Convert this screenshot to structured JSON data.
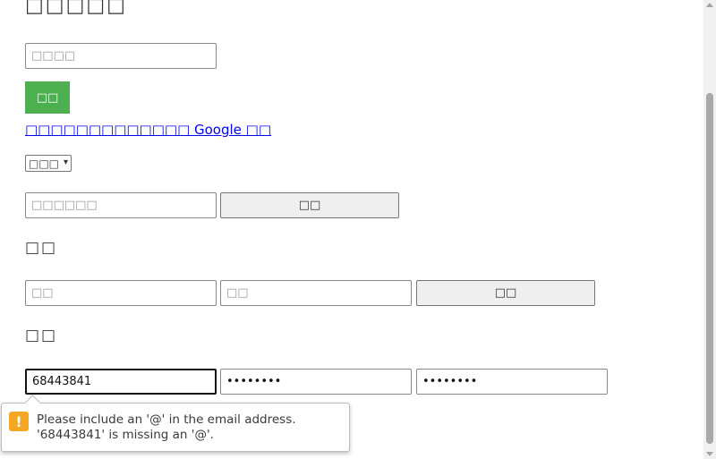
{
  "header": {
    "title": "□□□□□"
  },
  "search": {
    "placeholder": "□□□□",
    "submit_label": "□□"
  },
  "google_link": {
    "text": "□□□□□□□□□□□□□ Google □□"
  },
  "language_select": {
    "selected": "□□□"
  },
  "code_form": {
    "placeholder": "□□□□□□",
    "button_label": "□□"
  },
  "login": {
    "heading": "□□",
    "username_placeholder": "□□",
    "password_placeholder": "□□",
    "button_label": "□□"
  },
  "register": {
    "heading": "□□",
    "email_value": "68443841",
    "password_value": "••••••••",
    "confirm_value": "••••••••"
  },
  "validation": {
    "message_line1": "Please include an '@' in the email address.",
    "message_line2": "'68443841' is missing an '@'.",
    "icon": "warning-icon",
    "icon_color": "#f5a623"
  },
  "colors": {
    "accent_green": "#4caf50",
    "link_blue": "#0000ee"
  }
}
